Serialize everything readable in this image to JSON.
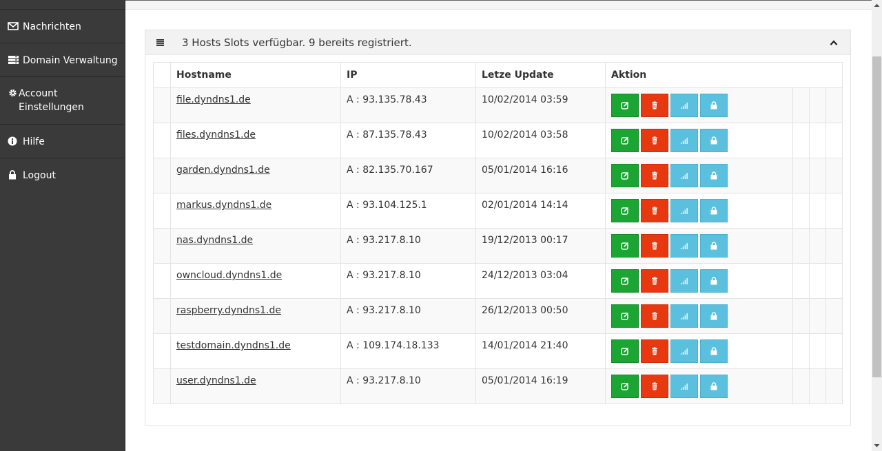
{
  "sidebar": {
    "items": [
      {
        "label": "Nachrichten",
        "icon": "envelope-icon"
      },
      {
        "label": "Domain Verwaltung",
        "icon": "server-icon"
      },
      {
        "label": "Account Einstellungen",
        "icon": "gear-icon"
      },
      {
        "label": "Hilfe",
        "icon": "info-icon"
      },
      {
        "label": "Logout",
        "icon": "lock-icon"
      }
    ]
  },
  "panel": {
    "title": "3 Hosts Slots verfügbar. 9 bereits registriert.",
    "table": {
      "headers": [
        "Hostname",
        "IP",
        "Letze Update",
        "Aktion"
      ],
      "rows": [
        {
          "hostname": "file.dyndns1.de",
          "ip": "A : 93.135.78.43",
          "updated": "10/02/2014 03:59"
        },
        {
          "hostname": "files.dyndns1.de",
          "ip": "A : 87.135.78.43",
          "updated": "10/02/2014 03:58"
        },
        {
          "hostname": "garden.dyndns1.de",
          "ip": "A : 82.135.70.167",
          "updated": "05/01/2014 16:16"
        },
        {
          "hostname": "markus.dyndns1.de",
          "ip": "A : 93.104.125.1",
          "updated": "02/01/2014 14:14"
        },
        {
          "hostname": "nas.dyndns1.de",
          "ip": "A : 93.217.8.10",
          "updated": "19/12/2013 00:17"
        },
        {
          "hostname": "owncloud.dyndns1.de",
          "ip": "A : 93.217.8.10",
          "updated": "24/12/2013 03:04"
        },
        {
          "hostname": "raspberry.dyndns1.de",
          "ip": "A : 93.217.8.10",
          "updated": "26/12/2013 00:50"
        },
        {
          "hostname": "testdomain.dyndns1.de",
          "ip": "A : 109.174.18.133",
          "updated": "14/01/2014 21:40"
        },
        {
          "hostname": "user.dyndns1.de",
          "ip": "A : 93.217.8.10",
          "updated": "05/01/2014 16:19"
        }
      ]
    }
  },
  "colors": {
    "sidebar_bg": "#3a3a3a",
    "edit_button": "#1ba532",
    "delete_button": "#e8380f",
    "info_button": "#5bc0de"
  }
}
